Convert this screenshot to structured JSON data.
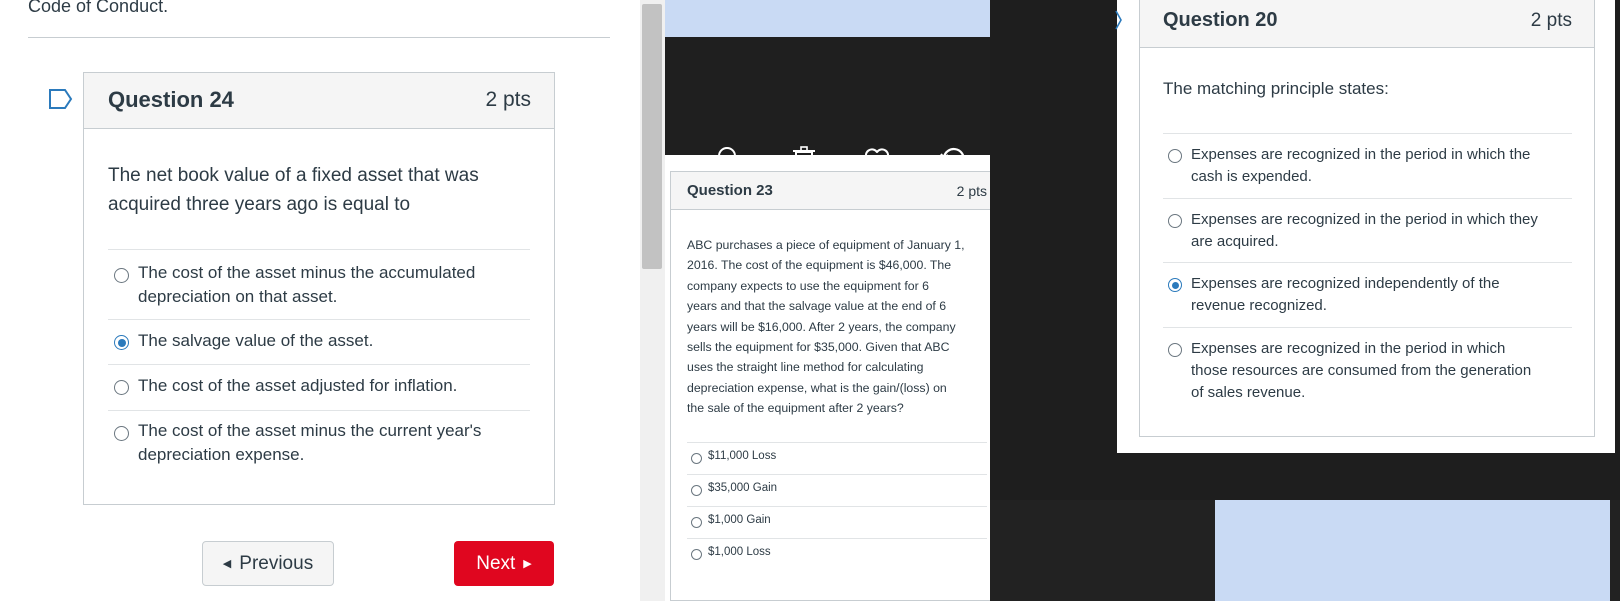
{
  "left": {
    "header_text": "Code of Conduct.",
    "question": {
      "title": "Question 24",
      "points": "2 pts",
      "prompt_line1": "The net book value of a fixed asset that was",
      "prompt_line2": "acquired three years ago is equal to",
      "answers": [
        {
          "line1": "The cost of the asset minus the accumulated",
          "line2": "depreciation on that asset.",
          "selected": false
        },
        {
          "line1": "The salvage value of the asset.",
          "line2": "",
          "selected": true
        },
        {
          "line1": "The cost of the asset adjusted for inflation.",
          "line2": "",
          "selected": false
        },
        {
          "line1": "The cost of the asset minus the current year's",
          "line2": "depreciation expense.",
          "selected": false
        }
      ]
    },
    "nav": {
      "previous_label": "Previous",
      "next_label": "Next"
    }
  },
  "middle": {
    "toolbar_icons": [
      "zoom-out-icon",
      "trash-icon",
      "heart-icon",
      "rotate-icon"
    ],
    "question": {
      "title": "Question 23",
      "points": "2 pts",
      "prompt_lines": [
        "ABC purchases a piece of equipment of January 1,",
        "2016.  The cost of the equipment is $46,000.  The",
        "company expects to use the equipment for 6",
        "years and that the salvage value at the end of 6",
        "years will be $16,000.  After 2 years, the company",
        "sells the equipment for $35,000.  Given that ABC",
        "uses the straight line method for calculating",
        "depreciation expense, what is the gain/(loss) on",
        "the sale of the equipment after 2 years?"
      ],
      "answers": [
        "$11,000 Loss",
        "$35,000 Gain",
        "$1,000 Gain",
        "$1,000 Loss"
      ]
    }
  },
  "right": {
    "question": {
      "title": "Question 20",
      "points": "2 pts",
      "prompt": "The matching principle states:",
      "answers": [
        {
          "line1": "Expenses are recognized in the period in which the",
          "line2": "cash is expended.",
          "line3": "",
          "selected": false
        },
        {
          "line1": "Expenses are recognized in the period in which they",
          "line2": "are acquired.",
          "line3": "",
          "selected": false
        },
        {
          "line1": "Expenses are recognized independently of the",
          "line2": "revenue recognized.",
          "line3": "",
          "selected": true
        },
        {
          "line1": "Expenses are recognized in the period in which",
          "line2": "those resources are consumed from the generation",
          "line3": "of sales revenue.",
          "selected": false
        }
      ]
    }
  },
  "colors": {
    "accent": "#2b7abc",
    "next_button": "#e0061f",
    "popup_overlay": "#1e1e1e",
    "panel_blue": "#c9daf4"
  }
}
